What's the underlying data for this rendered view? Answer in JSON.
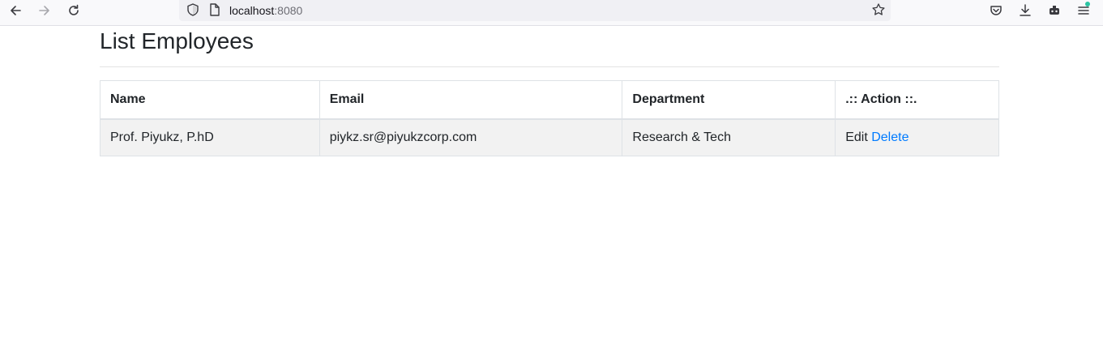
{
  "browser": {
    "url_host": "localhost",
    "url_port": ":8080"
  },
  "page": {
    "title": "List Employees"
  },
  "table": {
    "headers": [
      "Name",
      "Email",
      "Department",
      ".:: Action ::."
    ],
    "rows": [
      {
        "name": "Prof. Piyukz, P.hD",
        "email": "piykz.sr@piyukzcorp.com",
        "department": "Research & Tech",
        "edit_label": "Edit",
        "delete_label": "Delete"
      }
    ]
  },
  "colors": {
    "link": "#007bff",
    "row_stripe": "#f2f2f2",
    "notification_dot": "#2ac3a2"
  }
}
